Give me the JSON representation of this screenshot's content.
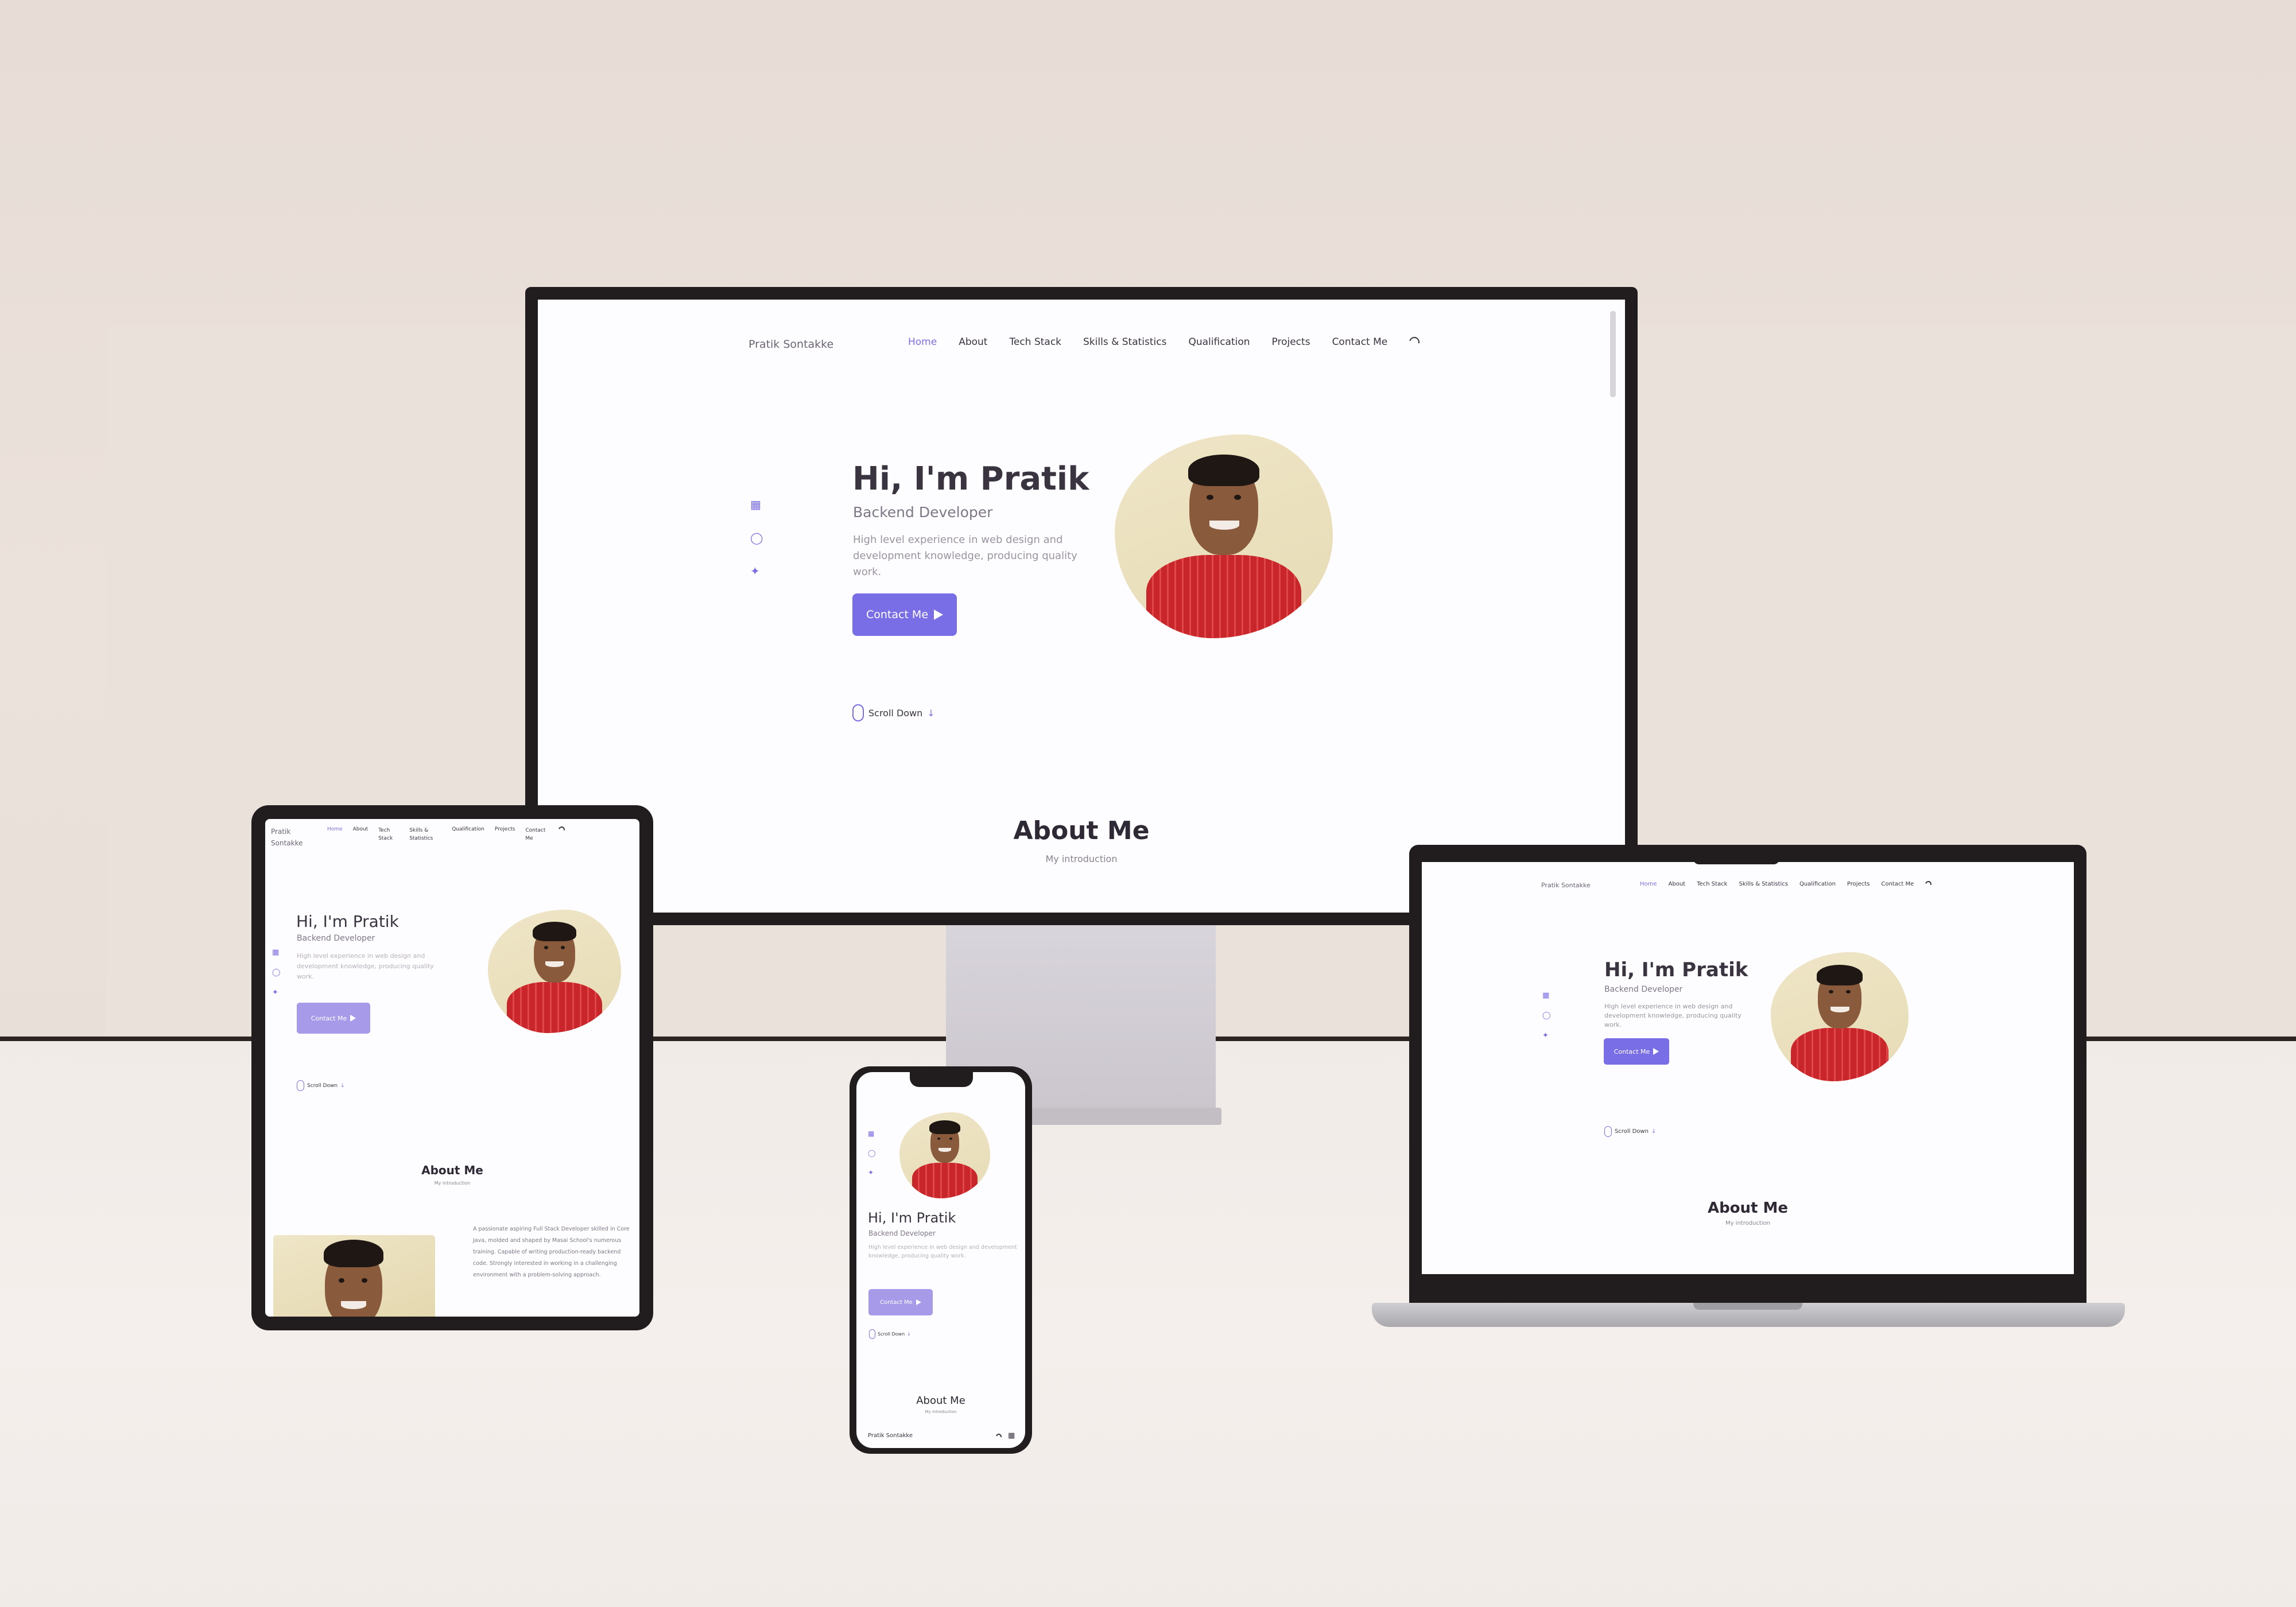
{
  "site": {
    "logo": "Pratik Sontakke",
    "nav": [
      {
        "label": "Home",
        "active": true
      },
      {
        "label": "About",
        "active": false
      },
      {
        "label": "Tech Stack",
        "active": false
      },
      {
        "label": "Skills & Statistics",
        "active": false
      },
      {
        "label": "Qualification",
        "active": false
      },
      {
        "label": "Projects",
        "active": false
      },
      {
        "label": "Contact Me",
        "active": false
      }
    ],
    "hero": {
      "title": "Hi, I'm Pratik",
      "subtitle": "Backend Developer",
      "description": "High level experience in web design and development knowledge, producing quality work.",
      "cta": "Contact Me"
    },
    "scroll_label": "Scroll Down",
    "about": {
      "title": "About Me",
      "subtitle": "My introduction",
      "text": "A passionate aspiring Full Stack Developer skilled in Core Java, molded and shaped by Masai School's numerous training. Capable of writing production-ready backend code. Strongly interested in working in a challenging environment with a problem-solving approach."
    },
    "social_icons": [
      "linkedin-icon",
      "github-icon",
      "twitter-icon"
    ],
    "colors": {
      "accent": "#7a6ee6",
      "text": "#3a3340",
      "muted": "#9a94a0"
    }
  }
}
